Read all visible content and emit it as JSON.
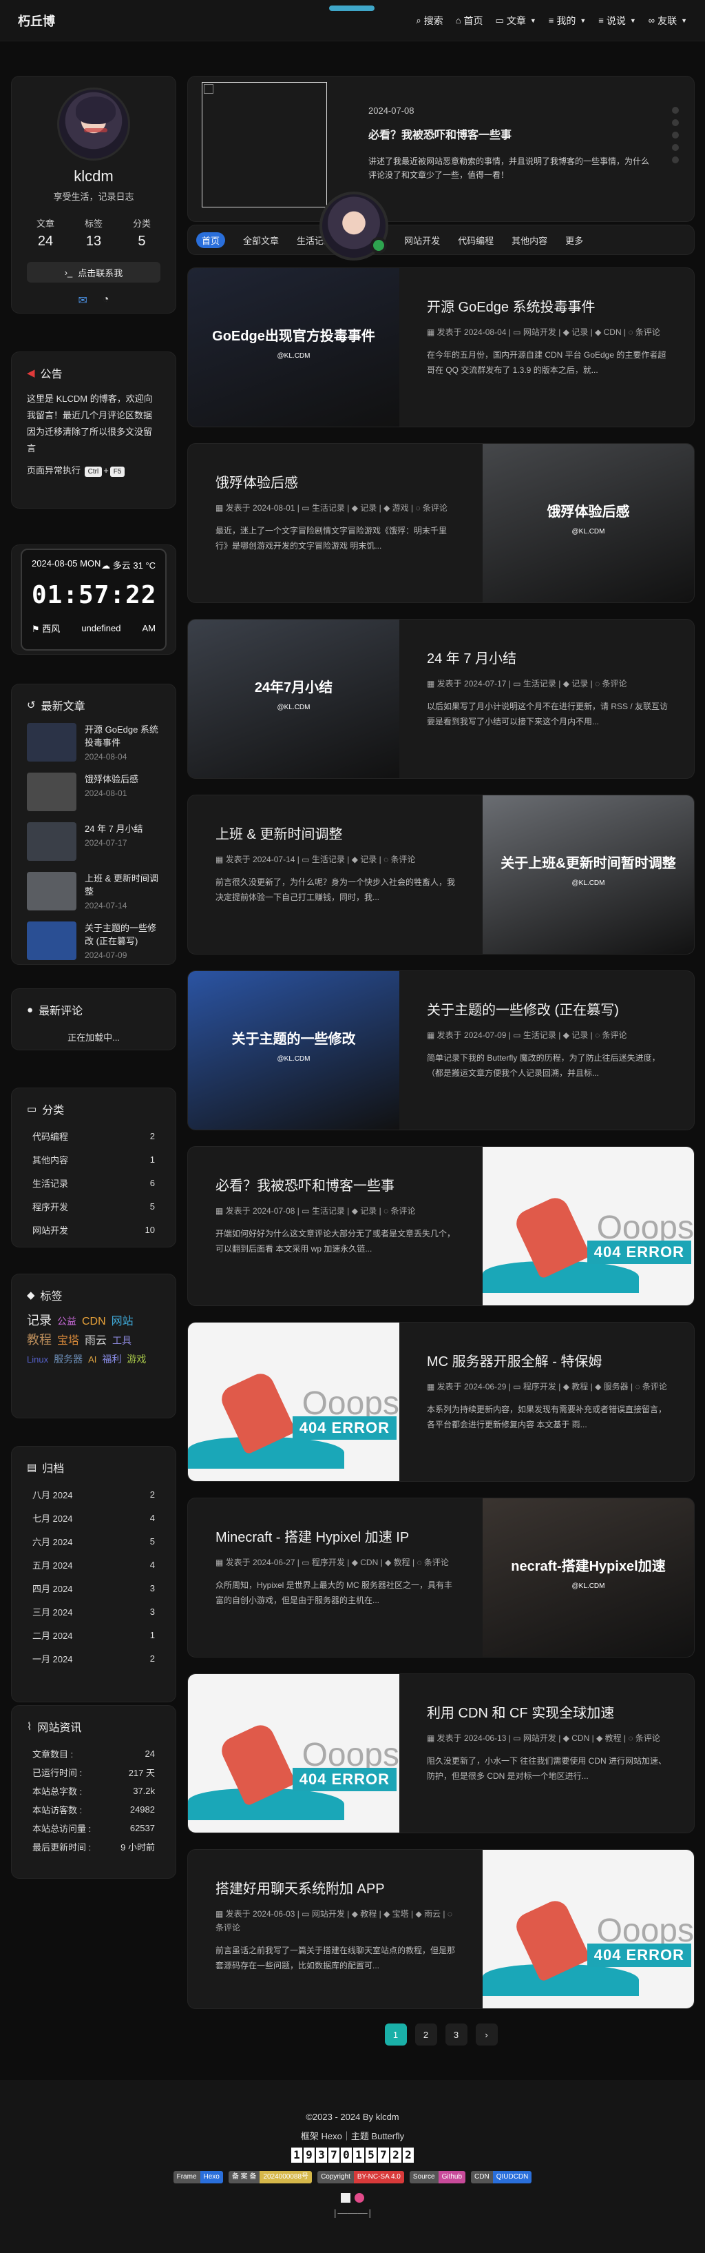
{
  "site": {
    "title": "朽丘博"
  },
  "nav": [
    {
      "icon": "search-icon",
      "glyph": "⌕",
      "label": "搜索",
      "caret": false
    },
    {
      "icon": "home-icon",
      "glyph": "⌂",
      "label": "首页",
      "caret": false
    },
    {
      "icon": "folder-icon",
      "glyph": "▭",
      "label": "文章",
      "caret": true
    },
    {
      "icon": "list-icon",
      "glyph": "≡",
      "label": "我的",
      "caret": true
    },
    {
      "icon": "list-icon",
      "glyph": "≡",
      "label": "说说",
      "caret": true
    },
    {
      "icon": "link-icon",
      "glyph": "∞",
      "label": "友联",
      "caret": true
    }
  ],
  "profile": {
    "name": "klcdm",
    "desc": "享受生活，记录日志",
    "stats": [
      {
        "label": "文章",
        "value": "24"
      },
      {
        "label": "标签",
        "value": "13"
      },
      {
        "label": "分类",
        "value": "5"
      }
    ],
    "contact": "点击联系我"
  },
  "notice": {
    "title": "公告",
    "text": "这里是 KLCDM 的博客，欢迎向我留言！最近几个月评论区数据因为迁移清除了所以很多文没留言",
    "exec_prefix": "页面异常执行",
    "key1": "Ctrl",
    "plus": "+",
    "key2": "F5"
  },
  "clock": {
    "date": "2024-08-05 MON",
    "weather": "☁ 多云 31 °C",
    "time": "01:57:22",
    "wind": "西风",
    "mid": "undefined",
    "ampm": "AM"
  },
  "recent": {
    "title": "最新文章",
    "items": [
      {
        "title": "开源 GoEdge 系统投毒事件",
        "date": "2024-08-04",
        "bg": "#2b3347"
      },
      {
        "title": "饿殍体验后感",
        "date": "2024-08-01",
        "bg": "#4a4a4a"
      },
      {
        "title": "24 年 7 月小结",
        "date": "2024-07-17",
        "bg": "#3a3f48"
      },
      {
        "title": "上班 & 更新时间调整",
        "date": "2024-07-14",
        "bg": "#5a5d62"
      },
      {
        "title": "关于主题的一些修改 (正在篡写)",
        "date": "2024-07-09",
        "bg": "#2a4f94"
      }
    ]
  },
  "comments": {
    "title": "最新评论",
    "loading": "正在加载中..."
  },
  "categories": {
    "title": "分类",
    "items": [
      {
        "name": "代码编程",
        "count": "2"
      },
      {
        "name": "其他内容",
        "count": "1"
      },
      {
        "name": "生活记录",
        "count": "6"
      },
      {
        "name": "程序开发",
        "count": "5"
      },
      {
        "name": "网站开发",
        "count": "10"
      }
    ]
  },
  "tags": {
    "title": "标签",
    "items": [
      {
        "name": "记录",
        "color": "#e6e6e6",
        "size": "18px"
      },
      {
        "name": "公益",
        "color": "#c86ad8",
        "size": "14px"
      },
      {
        "name": "CDN",
        "color": "#e8a23a",
        "size": "16px"
      },
      {
        "name": "网站",
        "color": "#3fa9d8",
        "size": "16px"
      },
      {
        "name": "教程",
        "color": "#b98c5a",
        "size": "18px"
      },
      {
        "name": "宝塔",
        "color": "#d98a3a",
        "size": "16px"
      },
      {
        "name": "雨云",
        "color": "#cfcfcf",
        "size": "16px"
      },
      {
        "name": "工具",
        "color": "#8a86d8",
        "size": "14px"
      },
      {
        "name": "Linux",
        "color": "#5560c8",
        "size": "13px"
      },
      {
        "name": "服务器",
        "color": "#6d8fb8",
        "size": "14px"
      },
      {
        "name": "AI",
        "color": "#d9a040",
        "size": "13px"
      },
      {
        "name": "福利",
        "color": "#8a8de8",
        "size": "14px"
      },
      {
        "name": "游戏",
        "color": "#a8c84a",
        "size": "14px"
      }
    ]
  },
  "archive": {
    "title": "归档",
    "items": [
      {
        "month": "八月 2024",
        "count": "2"
      },
      {
        "month": "七月 2024",
        "count": "4"
      },
      {
        "month": "六月 2024",
        "count": "5"
      },
      {
        "month": "五月 2024",
        "count": "4"
      },
      {
        "month": "四月 2024",
        "count": "3"
      },
      {
        "month": "三月 2024",
        "count": "3"
      },
      {
        "month": "二月 2024",
        "count": "1"
      },
      {
        "month": "一月 2024",
        "count": "2"
      }
    ]
  },
  "siteinfo": {
    "title": "网站资讯",
    "items": [
      {
        "k": "文章数目 :",
        "v": "24"
      },
      {
        "k": "已运行时间 :",
        "v": "217 天"
      },
      {
        "k": "本站总字数 :",
        "v": "37.2k"
      },
      {
        "k": "本站访客数 :",
        "v": "24982"
      },
      {
        "k": "本站总访问量 :",
        "v": "62537"
      },
      {
        "k": "最后更新时间 :",
        "v": "9 小时前"
      }
    ]
  },
  "feature": {
    "date": "2024-07-08",
    "title": "必看？我被恐吓和博客一些事",
    "excerpt": "讲述了我最近被网站恶意勒索的事情，并且说明了我博客的一些事情，为什么评论没了和文章少了一些，值得一看！"
  },
  "catnav": [
    "首页",
    "全部文章",
    "生活记录",
    "程序开发",
    "网站开发",
    "代码编程",
    "其他内容",
    "更多"
  ],
  "posts": [
    {
      "title": "开源 GoEdge 系统投毒事件",
      "date": "2024-08-04",
      "cat": "网站开发",
      "tags": [
        "记录",
        "CDN"
      ],
      "comments": "条评论",
      "excerpt": "在今年的五月份，国内开源自建 CDN 平台 GoEdge 的主要作者超哥在 QQ 交流群发布了 1.3.9 的版本之后，就...",
      "img_side": "left",
      "img_type": "photo",
      "img_text": "GoEdge出现官方投毒事件",
      "img_bg": "#1f2433"
    },
    {
      "title": "饿殍体验后感",
      "date": "2024-08-01",
      "cat": "生活记录",
      "tags": [
        "记录",
        "游戏"
      ],
      "comments": "条评论",
      "excerpt": "最近，迷上了一个文字冒险剧情文字冒险游戏《饿殍：明末千里行》是哪创游戏开发的文字冒险游戏 明末饥...",
      "img_side": "right",
      "img_type": "photo",
      "img_text": "饿殍体验后感",
      "img_bg": "#45474a"
    },
    {
      "title": "24 年 7 月小结",
      "date": "2024-07-17",
      "cat": "生活记录",
      "tags": [
        "记录"
      ],
      "comments": "条评论",
      "excerpt": "以后如果写了月小计说明这个月不在进行更新，请 RSS / 友联互访要是看到我写了小结可以接下来这个月内不用...",
      "img_side": "left",
      "img_type": "photo",
      "img_text": "24年7月小结",
      "img_bg": "#3b4049"
    },
    {
      "title": "上班 & 更新时间调整",
      "date": "2024-07-14",
      "cat": "生活记录",
      "tags": [
        "记录"
      ],
      "comments": "条评论",
      "excerpt": "前言很久没更新了，为什么呢？身为一个快步入社会的牲畜人，我决定提前体验一下自己打工赚钱，同时，我...",
      "img_side": "right",
      "img_type": "photo",
      "img_text": "关于上班&更新时间暂时调整",
      "img_bg": "#6a6d72"
    },
    {
      "title": "关于主题的一些修改 (正在篡写)",
      "date": "2024-07-09",
      "cat": "生活记录",
      "tags": [
        "记录"
      ],
      "comments": "条评论",
      "excerpt": "简单记录下我的 Butterfly 魔改的历程，为了防止往后迷失进度，（都是搬运文章方便我个人记录回溯，并且标...",
      "img_side": "left",
      "img_type": "photo",
      "img_text": "关于主题的一些修改",
      "img_bg": "#2b54a3"
    },
    {
      "title": "必看？我被恐吓和博客一些事",
      "date": "2024-07-08",
      "cat": "生活记录",
      "tags": [
        "记录"
      ],
      "comments": "条评论",
      "excerpt": "开端如何好好为什么这文章评论大部分无了或者是文章丢失几个，可以翻到后面看 本文采用 wp 加速永久链...",
      "img_side": "right",
      "img_type": "error",
      "img_text": "404 ERROR",
      "img_bg": "#f4f4f4"
    },
    {
      "title": "MC 服务器开服全解 - 特保姆",
      "date": "2024-06-29",
      "cat": "程序开发",
      "tags": [
        "教程",
        "服务器"
      ],
      "comments": "条评论",
      "excerpt": "本系列为持续更新内容，如果发现有需要补充或者错误直接留言，各平台都会进行更新修复内容 本文基于 雨...",
      "img_side": "left",
      "img_type": "error",
      "img_text": "404 ERROR",
      "img_bg": "#f4f4f4"
    },
    {
      "title": "Minecraft - 搭建 Hypixel 加速 IP",
      "date": "2024-06-27",
      "cat": "程序开发",
      "tags": [
        "CDN",
        "教程"
      ],
      "comments": "条评论",
      "excerpt": "众所周知，Hypixel 是世界上最大的 MC 服务器社区之一，具有丰富的自创小游戏，但是由于服务器的主机在...",
      "img_side": "right",
      "img_type": "photo",
      "img_text": "necraft-搭建Hypixel加速",
      "img_bg": "#3a3430"
    },
    {
      "title": "利用 CDN 和 CF 实现全球加速",
      "date": "2024-06-13",
      "cat": "网站开发",
      "tags": [
        "CDN",
        "教程"
      ],
      "comments": "条评论",
      "excerpt": "阻久没更新了，小水一下 往往我们需要使用 CDN 进行网站加速、防护，但是很多 CDN 是对标一个地区进行...",
      "img_side": "left",
      "img_type": "error",
      "img_text": "404 ERROR",
      "img_bg": "#f4f4f4"
    },
    {
      "title": "搭建好用聊天系统附加 APP",
      "date": "2024-06-03",
      "cat": "网站开发",
      "tags": [
        "教程",
        "宝塔",
        "雨云"
      ],
      "comments": "条评论",
      "excerpt": "前言虽话之前我写了一篇关于搭建在线聊天室站点的教程，但是那套源码存在一些问题，比如数据库的配置可...",
      "img_side": "right",
      "img_type": "error",
      "img_text": "404 ERROR",
      "img_bg": "#f4f4f4"
    }
  ],
  "post_meta": {
    "published": "发表于",
    "ooops": "Ooops",
    "watermark": "@KL.CDM"
  },
  "pager": [
    "1",
    "2",
    "3",
    "›"
  ],
  "footer": {
    "copyright": "©2023 - 2024 By klcdm",
    "framework": "框架 Hexo｜主题 Butterfly",
    "counter": "1937015722",
    "badges": [
      {
        "k": "Frame",
        "v": "Hexo",
        "color": "#2a6fdb"
      },
      {
        "k": "备 案 备",
        "v": "2024000088号",
        "color": "#d6b84a"
      },
      {
        "k": "Copyright",
        "v": "BY-NC-SA 4.0",
        "color": "#d83a3a"
      },
      {
        "k": "Source",
        "v": "Github",
        "color": "#c84a9a"
      },
      {
        "k": "CDN",
        "v": "QIUDCDN",
        "color": "#2a6fdb"
      }
    ],
    "bottom": "|——————|"
  }
}
